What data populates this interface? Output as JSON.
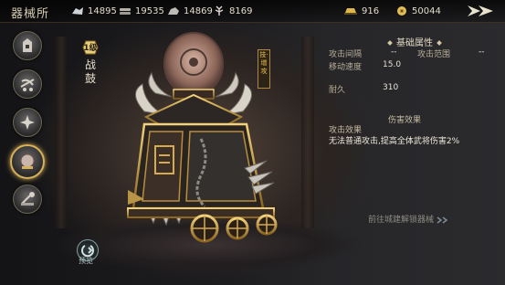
{
  "header": {
    "title": "器械所"
  },
  "resources": [
    {
      "icon": "silver-ore-icon",
      "value": "14895"
    },
    {
      "icon": "wood-icon",
      "value": "19535"
    },
    {
      "icon": "stone-icon",
      "value": "14869"
    },
    {
      "icon": "grain-icon",
      "value": "8169"
    },
    {
      "icon": "gold-ingot-icon",
      "value": "916"
    },
    {
      "icon": "copper-coin-icon",
      "value": "50044"
    }
  ],
  "sidebar": {
    "items": [
      {
        "name": "siege-tower"
      },
      {
        "name": "ballista"
      },
      {
        "name": "spiked-cart"
      },
      {
        "name": "war-drum",
        "active": true
      },
      {
        "name": "catapult"
      }
    ]
  },
  "vehicle": {
    "level": "1级",
    "name": "战鼓",
    "tag": "技·增攻"
  },
  "stats": {
    "section_title": "基础属性",
    "attack_interval_label": "攻击间隔",
    "attack_interval_value": "--",
    "attack_range_label": "攻击范围",
    "attack_range_value": "--",
    "move_speed_label": "移动速度",
    "move_speed_value": "15.0",
    "durability_label": "耐久",
    "durability_value": "310"
  },
  "damage": {
    "section_title": "伤害效果",
    "effect_label": "攻击效果",
    "effect_text": "无法普通攻击,提高全体武将伤害2%"
  },
  "link": {
    "text": "前往城建解锁器械"
  },
  "preview": {
    "label": "预览"
  },
  "colors": {
    "accent_gold": "#d8b25a",
    "text_light": "#e8e2d2"
  }
}
